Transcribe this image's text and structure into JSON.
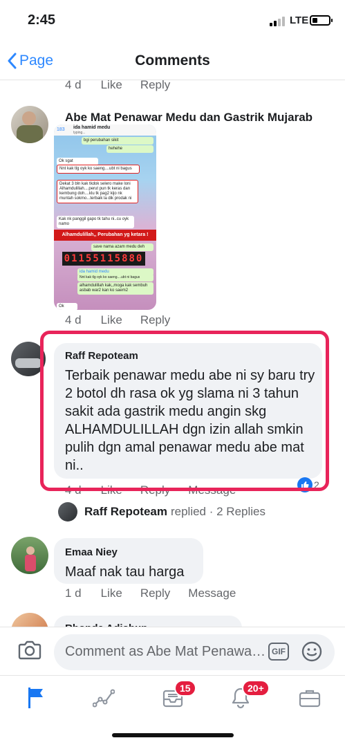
{
  "status": {
    "time": "2:45",
    "network": "LTE"
  },
  "nav": {
    "back": "Page",
    "title": "Comments"
  },
  "comment0": {
    "time": "4 d",
    "like": "Like",
    "reply": "Reply"
  },
  "comment1": {
    "name": "Abe Mat Penawar Medu dan Gastrik Mujarab",
    "image": {
      "header": "ida hamid medu",
      "header_sub": "typing...",
      "count": "183",
      "messages": [
        "bgi perubahan sikit",
        "hehehe",
        "Ok sgat",
        "Nnt kak tlg oyk ko saeng....ubt ni bagus",
        "Dekat 3 bln kak tkdok selero make loni Alhamdulillah....perut pun tk keras dan kembung doh....klu tk pag2 kijo nk muntah sokmo...terbaik la dik prodak ni",
        "Kak nk panggil gapo tk tahu ni..cu oyk namo",
        "save nama azam medu deh",
        "ida hamid medu",
        "Nnt kak tlg oyk ko saeng....ubt ni bagus",
        "alhamdulillah kak,,moga kak sembuh asbab war2 kan ko saem2"
      ],
      "banner": "Alhamdulillah,, Perubahan yg ketara !",
      "phone": "01155115880",
      "bottom": "Ok"
    },
    "time": "4 d",
    "like": "Like",
    "reply": "Reply"
  },
  "comment2": {
    "name": "Raff Repoteam",
    "text": "Terbaik penawar medu abe ni sy baru try 2 botol dh rasa ok yg slama ni 3 tahun sakit ada gastrik medu angin skg ALHAMDULILLAH dgn izin allah smkin pulih dgn amal penawar medu abe mat ni..",
    "time": "4 d",
    "like": "Like",
    "reply": "Reply",
    "message": "Message",
    "reactions": "2",
    "replied_name": "Raff Repoteam",
    "replied_text": "replied · 2 Replies"
  },
  "comment3": {
    "name": "Emaa Niey",
    "text": "Maaf nak tau harga",
    "time": "1 d",
    "like": "Like",
    "reply": "Reply",
    "message": "Message"
  },
  "comment4": {
    "name": "Rhonda Adishun"
  },
  "composer": {
    "placeholder": "Comment as Abe Mat Penawar Medu dan Gastrik Mujarab",
    "gif": "GIF"
  },
  "tabs": {
    "feed_badge": "15",
    "notif_badge": "20+"
  },
  "colors": {
    "accent": "#2d88ff",
    "highlight": "#e8245a",
    "badge": "#e41e3f"
  }
}
